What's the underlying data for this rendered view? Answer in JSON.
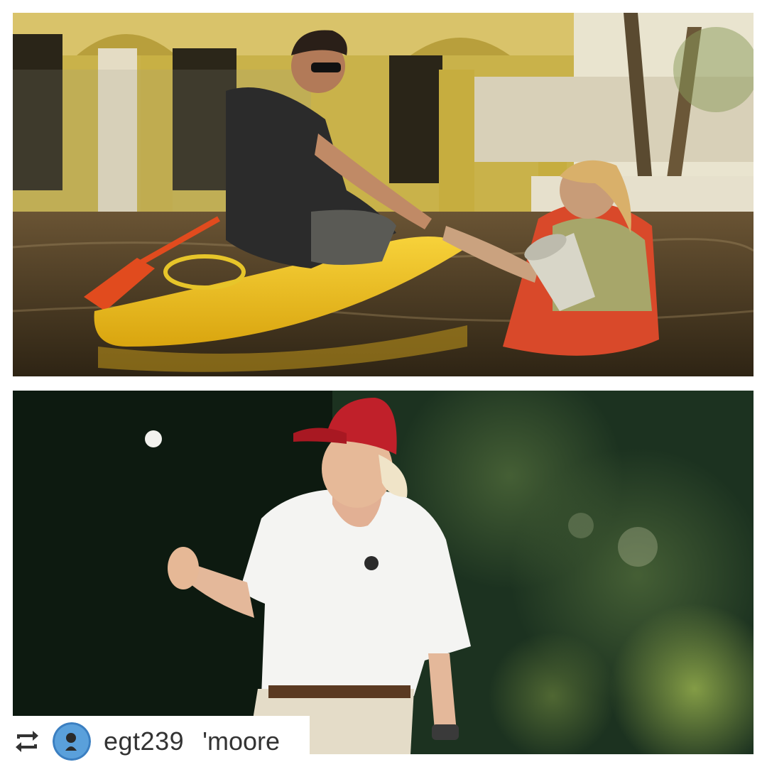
{
  "photos": {
    "top_description_icon": "flood-rescue-photo",
    "bottom_description_icon": "golf-photo"
  },
  "repost": {
    "icon": "repost-icon",
    "avatar_icon": "avatar",
    "username": "egt239",
    "original_handle_fragment": "'moore"
  },
  "colors": {
    "kayak": "#f2c21f",
    "flood_water": "#4a3a22",
    "cap": "#c0202a",
    "text": "#333333"
  }
}
